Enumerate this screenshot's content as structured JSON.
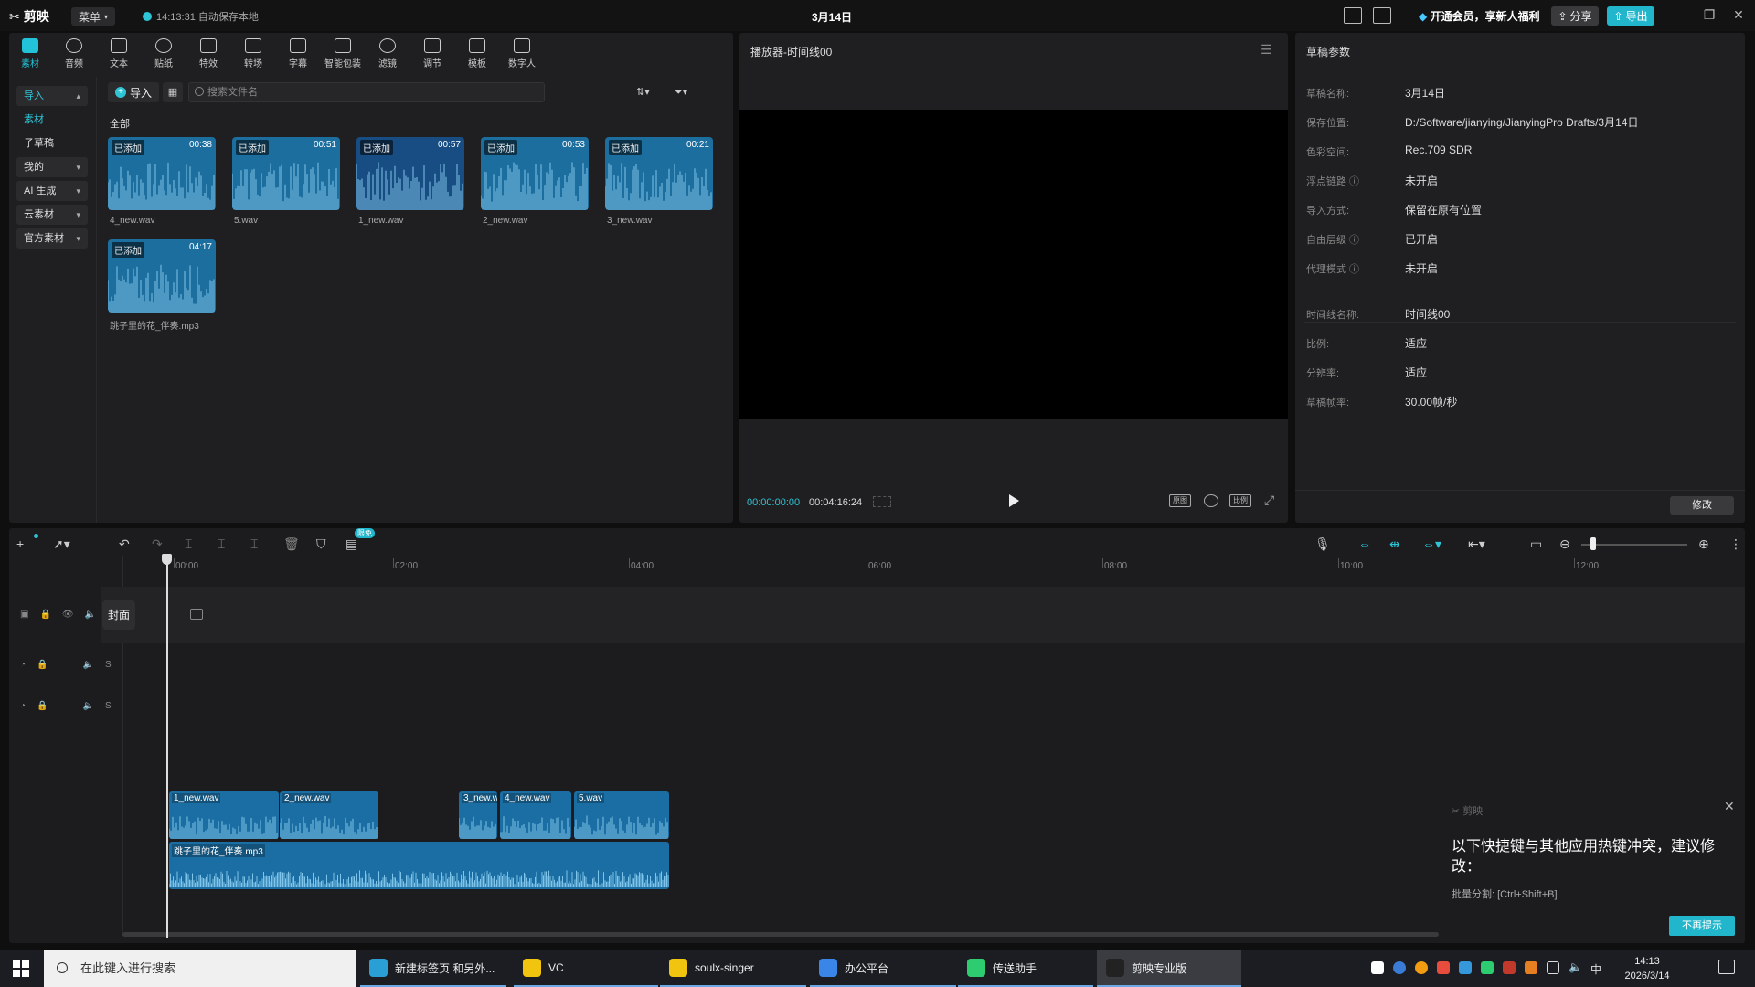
{
  "titlebar": {
    "app_name": "剪映",
    "menu_label": "菜单",
    "autosave_text": "14:13:31 自动保存本地",
    "project_title": "3月14日",
    "vip_text": "开通会员，享新人福利",
    "share_label": "分享",
    "export_label": "导出"
  },
  "toolbar": [
    {
      "label": "素材"
    },
    {
      "label": "音频"
    },
    {
      "label": "文本"
    },
    {
      "label": "贴纸"
    },
    {
      "label": "特效"
    },
    {
      "label": "转场"
    },
    {
      "label": "字幕"
    },
    {
      "label": "智能包装"
    },
    {
      "label": "滤镜"
    },
    {
      "label": "调节"
    },
    {
      "label": "模板"
    },
    {
      "label": "数字人"
    }
  ],
  "sidenav": {
    "import": "导入",
    "material": "素材",
    "subdraft": "子草稿",
    "mine": "我的",
    "ai": "AI 生成",
    "cloud": "云素材",
    "official": "官方素材"
  },
  "media": {
    "import_label": "导入",
    "search_placeholder": "搜索文件名",
    "section": "全部",
    "badge": "已添加",
    "clips": [
      {
        "name": "4_new.wav",
        "duration": "00:38"
      },
      {
        "name": "5.wav",
        "duration": "00:51"
      },
      {
        "name": "1_new.wav",
        "duration": "00:57"
      },
      {
        "name": "2_new.wav",
        "duration": "00:53"
      },
      {
        "name": "3_new.wav",
        "duration": "00:21"
      },
      {
        "name": "跳子里的花_伴奏.mp3",
        "duration": "04:17"
      }
    ]
  },
  "player": {
    "title": "播放器-时间线00",
    "current_time": "00:00:00:00",
    "total_time": "00:04:16:24",
    "btn_original": "原图",
    "btn_ratio": "比例"
  },
  "props": {
    "title": "草稿参数",
    "rows": [
      {
        "key": "草稿名称:",
        "value": "3月14日"
      },
      {
        "key": "保存位置:",
        "value": "D:/Software/jianying/JianyingPro Drafts/3月14日"
      },
      {
        "key": "色彩空间:",
        "value": "Rec.709 SDR"
      },
      {
        "key": "浮点链路 ⓘ",
        "value": "未开启"
      },
      {
        "key": "导入方式:",
        "value": "保留在原有位置"
      },
      {
        "key": "自由层级 ⓘ",
        "value": "已开启"
      },
      {
        "key": "代理模式 ⓘ",
        "value": "未开启"
      }
    ],
    "rows2": [
      {
        "key": "时间线名称:",
        "value": "时间线00"
      },
      {
        "key": "比例:",
        "value": "适应"
      },
      {
        "key": "分辨率:",
        "value": "适应"
      },
      {
        "key": "草稿帧率:",
        "value": "30.00帧/秒"
      }
    ],
    "modify_label": "修改"
  },
  "timeline": {
    "free_badge": "限免",
    "ruler": [
      "00:00",
      "02:00",
      "04:00",
      "06:00",
      "08:00",
      "10:00",
      "12:00"
    ],
    "cover_label": "封面",
    "track1_clips": [
      {
        "name": "1_new.wav"
      },
      {
        "name": "2_new.wav"
      },
      {
        "name": "3_new.w"
      },
      {
        "name": "4_new.wav"
      },
      {
        "name": "5.wav"
      }
    ],
    "track2_clip": "跳子里的花_伴奏.mp3"
  },
  "notification": {
    "brand": "剪映",
    "title": "以下快捷键与其他应用热键冲突，建议修改：",
    "body": "批量分割: [Ctrl+Shift+B]",
    "button": "不再提示"
  },
  "taskbar": {
    "search_placeholder": "在此键入进行搜索",
    "apps": [
      {
        "label": "新建标签页 和另外..."
      },
      {
        "label": "VC"
      },
      {
        "label": "soulx-singer"
      },
      {
        "label": "办公平台"
      },
      {
        "label": "传送助手"
      },
      {
        "label": "剪映专业版"
      }
    ],
    "ime": "中",
    "time": "14:13",
    "date": "2026/3/14"
  },
  "colors": {
    "accent": "#22c3d8",
    "clip_blue": "#1b6ea3",
    "panel": "#1f1f21"
  }
}
